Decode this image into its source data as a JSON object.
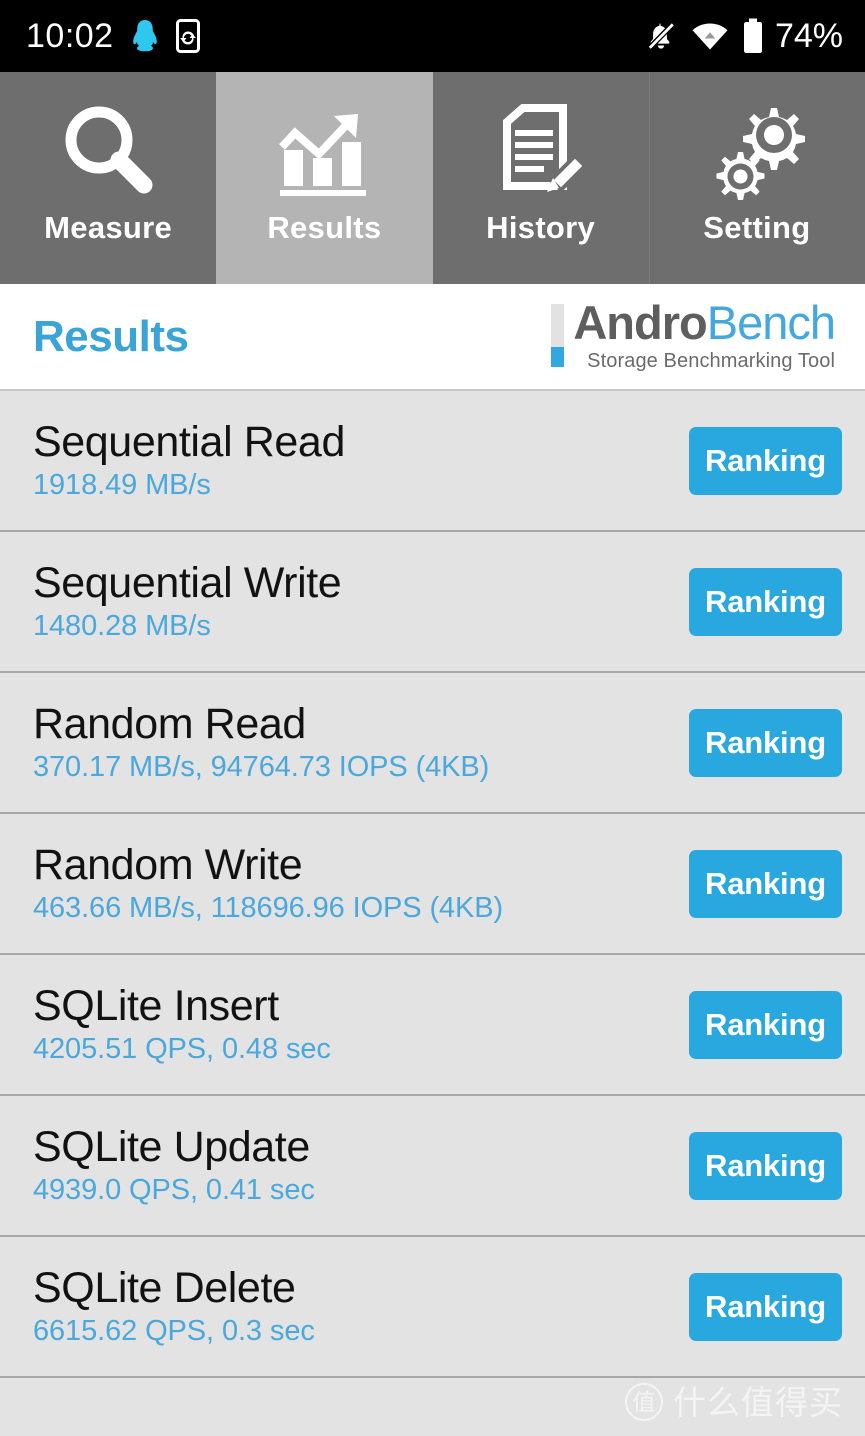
{
  "status_bar": {
    "time": "10:02",
    "battery_percent": "74%",
    "icons": [
      "qq-penguin-icon",
      "phone-sync-icon",
      "bell-muted-icon",
      "wifi-icon",
      "battery-icon"
    ]
  },
  "tabs": [
    {
      "label": "Measure",
      "icon": "magnifier-icon",
      "active": false
    },
    {
      "label": "Results",
      "icon": "bar-chart-arrow-icon",
      "active": true
    },
    {
      "label": "History",
      "icon": "document-pencil-icon",
      "active": false
    },
    {
      "label": "Setting",
      "icon": "gears-icon",
      "active": false
    }
  ],
  "header": {
    "title": "Results",
    "brand_primary": "Andro",
    "brand_secondary": "Bench",
    "brand_tagline": "Storage Benchmarking Tool"
  },
  "results": [
    {
      "name": "Sequential Read",
      "value": "1918.49 MB/s",
      "action": "Ranking"
    },
    {
      "name": "Sequential Write",
      "value": "1480.28 MB/s",
      "action": "Ranking"
    },
    {
      "name": "Random Read",
      "value": "370.17 MB/s, 94764.73 IOPS (4KB)",
      "action": "Ranking"
    },
    {
      "name": "Random Write",
      "value": "463.66 MB/s, 118696.96 IOPS (4KB)",
      "action": "Ranking"
    },
    {
      "name": "SQLite Insert",
      "value": "4205.51 QPS, 0.48 sec",
      "action": "Ranking"
    },
    {
      "name": "SQLite Update",
      "value": "4939.0 QPS, 0.41 sec",
      "action": "Ranking"
    },
    {
      "name": "SQLite Delete",
      "value": "6615.62 QPS, 0.3 sec",
      "action": "Ranking"
    }
  ],
  "watermark": {
    "logo_char": "值",
    "text": "什么值得买"
  },
  "colors": {
    "accent_blue": "#29a8e0",
    "title_blue": "#3aa4d6",
    "value_blue": "#4aa8dc",
    "tab_inactive": "#6e6e6e",
    "tab_active": "#b4b4b4",
    "list_bg": "#e3e3e3",
    "status_bar_bg": "#000000"
  }
}
